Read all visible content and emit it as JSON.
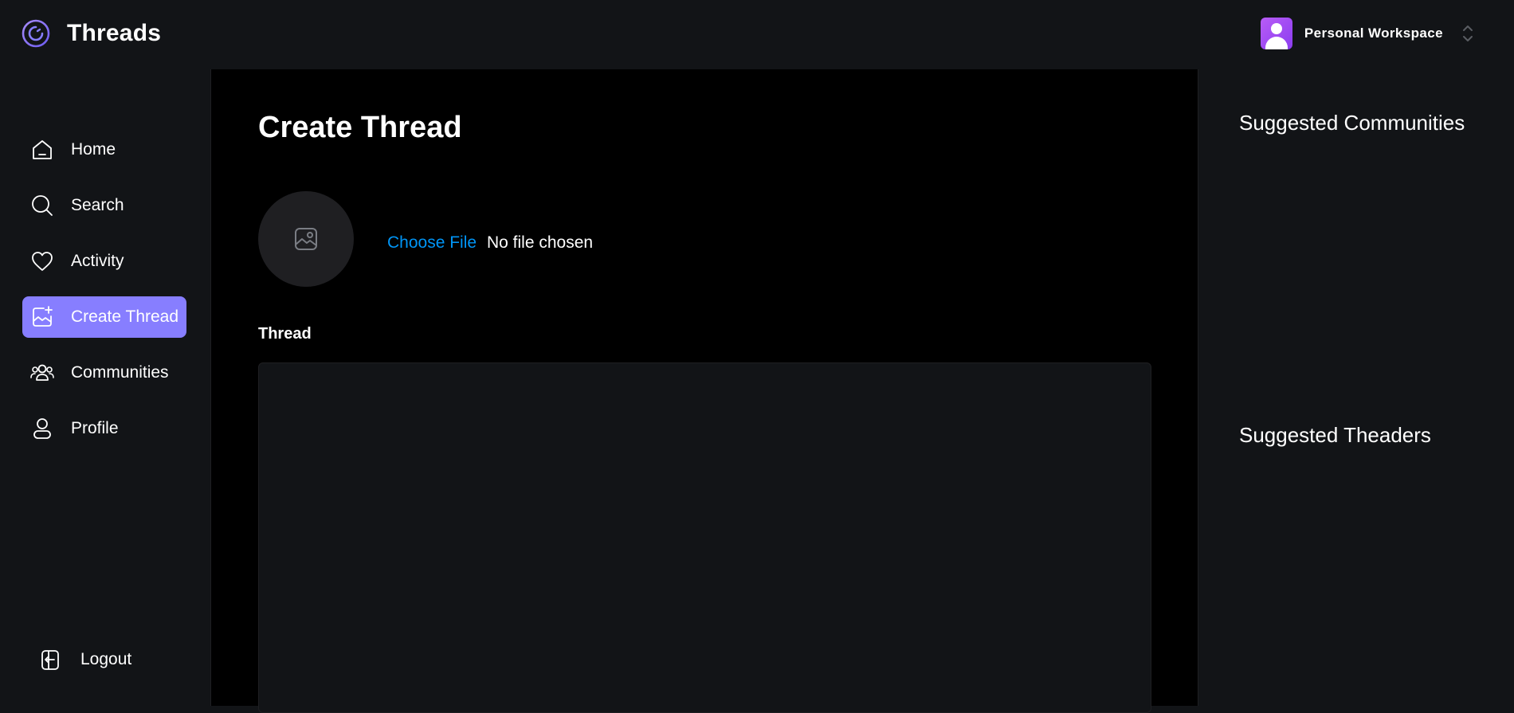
{
  "brand": {
    "name": "Threads",
    "icon": "threads-logo-icon"
  },
  "workspace": {
    "name": "Personal Workspace",
    "avatar_color": "#9a48f2"
  },
  "sidebar": {
    "items": [
      {
        "label": "Home",
        "icon": "home-icon"
      },
      {
        "label": "Search",
        "icon": "search-icon"
      },
      {
        "label": "Activity",
        "icon": "heart-icon"
      },
      {
        "label": "Create Thread",
        "icon": "create-thread-icon",
        "active": true
      },
      {
        "label": "Communities",
        "icon": "communities-icon"
      },
      {
        "label": "Profile",
        "icon": "profile-icon"
      }
    ],
    "logout_label": "Logout"
  },
  "main": {
    "title": "Create Thread",
    "file_input": {
      "button_label": "Choose File",
      "status": "No file chosen"
    },
    "thread_label": "Thread",
    "thread_value": ""
  },
  "rightbar": {
    "suggested_communities": "Suggested Communities",
    "suggested_threaders": "Suggested Theaders"
  },
  "colors": {
    "accent": "#877eff",
    "background_dark": "#121417",
    "main_background": "#000000",
    "link": "#0095f6"
  }
}
